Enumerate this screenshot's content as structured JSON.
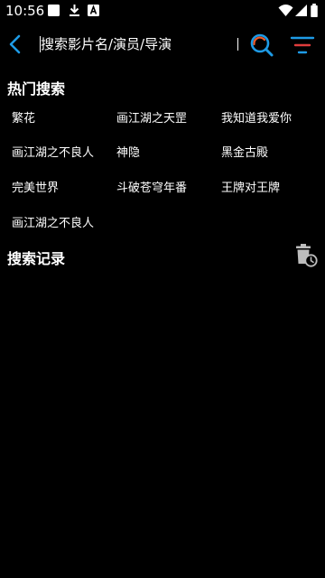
{
  "status_bar": {
    "time": "10:56"
  },
  "search": {
    "placeholder": "搜索影片名/演员/导演",
    "value": ""
  },
  "hot_search": {
    "title": "热门搜索",
    "items": [
      "繁花",
      "画江湖之天罡",
      "我知道我爱你",
      "画江湖之不良人",
      "神隐",
      "黑金古殿",
      "完美世界",
      "斗破苍穹年番",
      "王牌对王牌",
      "画江湖之不良人"
    ]
  },
  "history": {
    "title": "搜索记录",
    "items": []
  },
  "colors": {
    "accent": "#1e9be6",
    "search_icon_arc": "#f05a28",
    "filter_icon_accent": "#e03c3c",
    "background": "#000000"
  },
  "icons": [
    "image-icon",
    "download-icon",
    "font-icon",
    "wifi-icon",
    "signal-icon",
    "battery-icon",
    "back-arrow-icon",
    "search-icon",
    "filter-icon",
    "clear-history-icon"
  ]
}
